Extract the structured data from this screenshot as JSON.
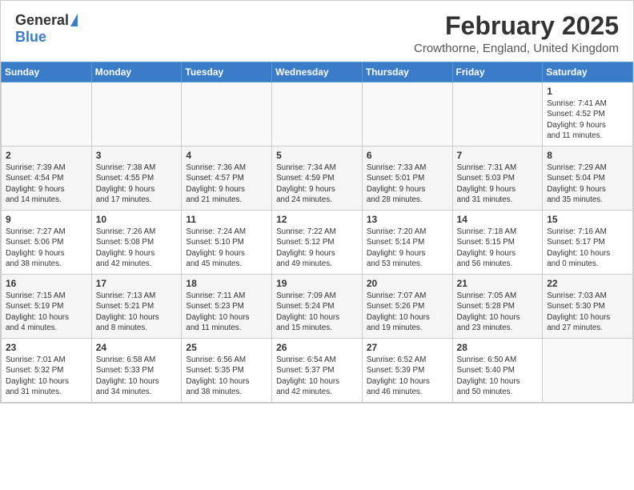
{
  "header": {
    "logo_general": "General",
    "logo_blue": "Blue",
    "month_year": "February 2025",
    "location": "Crowthorne, England, United Kingdom"
  },
  "weekdays": [
    "Sunday",
    "Monday",
    "Tuesday",
    "Wednesday",
    "Thursday",
    "Friday",
    "Saturday"
  ],
  "weeks": [
    [
      {
        "day": "",
        "info": ""
      },
      {
        "day": "",
        "info": ""
      },
      {
        "day": "",
        "info": ""
      },
      {
        "day": "",
        "info": ""
      },
      {
        "day": "",
        "info": ""
      },
      {
        "day": "",
        "info": ""
      },
      {
        "day": "1",
        "info": "Sunrise: 7:41 AM\nSunset: 4:52 PM\nDaylight: 9 hours\nand 11 minutes."
      }
    ],
    [
      {
        "day": "2",
        "info": "Sunrise: 7:39 AM\nSunset: 4:54 PM\nDaylight: 9 hours\nand 14 minutes."
      },
      {
        "day": "3",
        "info": "Sunrise: 7:38 AM\nSunset: 4:55 PM\nDaylight: 9 hours\nand 17 minutes."
      },
      {
        "day": "4",
        "info": "Sunrise: 7:36 AM\nSunset: 4:57 PM\nDaylight: 9 hours\nand 21 minutes."
      },
      {
        "day": "5",
        "info": "Sunrise: 7:34 AM\nSunset: 4:59 PM\nDaylight: 9 hours\nand 24 minutes."
      },
      {
        "day": "6",
        "info": "Sunrise: 7:33 AM\nSunset: 5:01 PM\nDaylight: 9 hours\nand 28 minutes."
      },
      {
        "day": "7",
        "info": "Sunrise: 7:31 AM\nSunset: 5:03 PM\nDaylight: 9 hours\nand 31 minutes."
      },
      {
        "day": "8",
        "info": "Sunrise: 7:29 AM\nSunset: 5:04 PM\nDaylight: 9 hours\nand 35 minutes."
      }
    ],
    [
      {
        "day": "9",
        "info": "Sunrise: 7:27 AM\nSunset: 5:06 PM\nDaylight: 9 hours\nand 38 minutes."
      },
      {
        "day": "10",
        "info": "Sunrise: 7:26 AM\nSunset: 5:08 PM\nDaylight: 9 hours\nand 42 minutes."
      },
      {
        "day": "11",
        "info": "Sunrise: 7:24 AM\nSunset: 5:10 PM\nDaylight: 9 hours\nand 45 minutes."
      },
      {
        "day": "12",
        "info": "Sunrise: 7:22 AM\nSunset: 5:12 PM\nDaylight: 9 hours\nand 49 minutes."
      },
      {
        "day": "13",
        "info": "Sunrise: 7:20 AM\nSunset: 5:14 PM\nDaylight: 9 hours\nand 53 minutes."
      },
      {
        "day": "14",
        "info": "Sunrise: 7:18 AM\nSunset: 5:15 PM\nDaylight: 9 hours\nand 56 minutes."
      },
      {
        "day": "15",
        "info": "Sunrise: 7:16 AM\nSunset: 5:17 PM\nDaylight: 10 hours\nand 0 minutes."
      }
    ],
    [
      {
        "day": "16",
        "info": "Sunrise: 7:15 AM\nSunset: 5:19 PM\nDaylight: 10 hours\nand 4 minutes."
      },
      {
        "day": "17",
        "info": "Sunrise: 7:13 AM\nSunset: 5:21 PM\nDaylight: 10 hours\nand 8 minutes."
      },
      {
        "day": "18",
        "info": "Sunrise: 7:11 AM\nSunset: 5:23 PM\nDaylight: 10 hours\nand 11 minutes."
      },
      {
        "day": "19",
        "info": "Sunrise: 7:09 AM\nSunset: 5:24 PM\nDaylight: 10 hours\nand 15 minutes."
      },
      {
        "day": "20",
        "info": "Sunrise: 7:07 AM\nSunset: 5:26 PM\nDaylight: 10 hours\nand 19 minutes."
      },
      {
        "day": "21",
        "info": "Sunrise: 7:05 AM\nSunset: 5:28 PM\nDaylight: 10 hours\nand 23 minutes."
      },
      {
        "day": "22",
        "info": "Sunrise: 7:03 AM\nSunset: 5:30 PM\nDaylight: 10 hours\nand 27 minutes."
      }
    ],
    [
      {
        "day": "23",
        "info": "Sunrise: 7:01 AM\nSunset: 5:32 PM\nDaylight: 10 hours\nand 31 minutes."
      },
      {
        "day": "24",
        "info": "Sunrise: 6:58 AM\nSunset: 5:33 PM\nDaylight: 10 hours\nand 34 minutes."
      },
      {
        "day": "25",
        "info": "Sunrise: 6:56 AM\nSunset: 5:35 PM\nDaylight: 10 hours\nand 38 minutes."
      },
      {
        "day": "26",
        "info": "Sunrise: 6:54 AM\nSunset: 5:37 PM\nDaylight: 10 hours\nand 42 minutes."
      },
      {
        "day": "27",
        "info": "Sunrise: 6:52 AM\nSunset: 5:39 PM\nDaylight: 10 hours\nand 46 minutes."
      },
      {
        "day": "28",
        "info": "Sunrise: 6:50 AM\nSunset: 5:40 PM\nDaylight: 10 hours\nand 50 minutes."
      },
      {
        "day": "",
        "info": ""
      }
    ]
  ]
}
